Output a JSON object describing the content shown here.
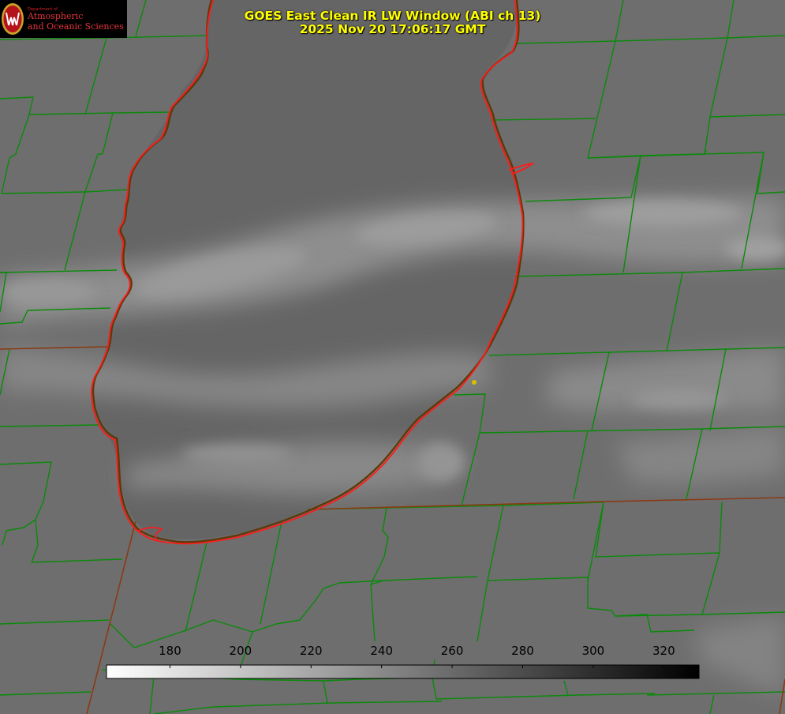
{
  "logo": {
    "org_small": "Department of",
    "org_line1": "Atmospheric",
    "org_line2": "and Oceanic Sciences"
  },
  "header": {
    "title_line1": "GOES East Clean IR LW Window (ABI ch 13)",
    "title_line2": "2025 Nov 20 17:06:17 GMT"
  },
  "colorbar": {
    "tick_labels": [
      "180",
      "200",
      "220",
      "240",
      "260",
      "280",
      "300",
      "320"
    ],
    "tick_values": [
      180,
      200,
      220,
      240,
      260,
      280,
      300,
      320
    ],
    "range": [
      162,
      330
    ],
    "colormap": "white (cold) to black (warm) grayscale"
  },
  "colors": {
    "background_gray": "#6e6e6e",
    "lake_outline_red": "#ff1a1a",
    "county_lines_green": "#0a8a0a",
    "state_lines_brown": "#8a3a14",
    "title_yellow": "#ffff00",
    "marker_yellow": "#d8c000"
  }
}
